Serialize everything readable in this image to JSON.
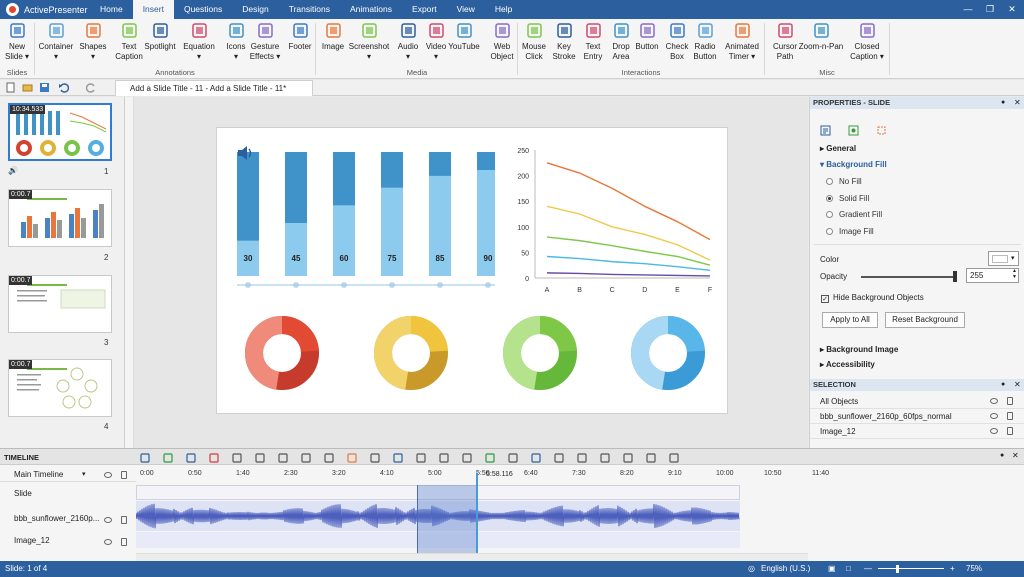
{
  "app": {
    "name": "ActivePresenter"
  },
  "menu_tabs": [
    "Home",
    "Insert",
    "Questions",
    "Design",
    "Transitions",
    "Animations",
    "Export",
    "View",
    "Help"
  ],
  "ribbon": {
    "slides": [
      {
        "label": "New",
        "label2": "Slide ▾"
      }
    ],
    "annotations": [
      {
        "label": "Container",
        "label2": "▾"
      },
      {
        "label": "Shapes",
        "label2": "▾"
      },
      {
        "label": "Text",
        "label2": "Caption"
      },
      {
        "label": "Spotlight",
        "label2": ""
      },
      {
        "label": "Equation",
        "label2": "▾"
      },
      {
        "label": "Icons",
        "label2": "▾"
      },
      {
        "label": "Gesture",
        "label2": "Effects ▾"
      },
      {
        "label": "Footer",
        "label2": ""
      }
    ],
    "media": [
      {
        "label": "Image",
        "label2": ""
      },
      {
        "label": "Screenshot",
        "label2": "▾"
      },
      {
        "label": "Audio",
        "label2": "▾"
      },
      {
        "label": "Video",
        "label2": "▾"
      },
      {
        "label": "YouTube",
        "label2": ""
      },
      {
        "label": "Web",
        "label2": "Object"
      }
    ],
    "interactions": [
      {
        "label": "Mouse",
        "label2": "Click"
      },
      {
        "label": "Key",
        "label2": "Stroke"
      },
      {
        "label": "Text",
        "label2": "Entry"
      },
      {
        "label": "Drop",
        "label2": "Area"
      },
      {
        "label": "Button",
        "label2": ""
      },
      {
        "label": "Check",
        "label2": "Box"
      },
      {
        "label": "Radio",
        "label2": "Button"
      },
      {
        "label": "Animated",
        "label2": "Timer ▾"
      }
    ],
    "misc": [
      {
        "label": "Cursor",
        "label2": "Path"
      },
      {
        "label": "Zoom-n-Pan",
        "label2": ""
      },
      {
        "label": "Closed",
        "label2": "Caption ▾"
      }
    ],
    "groups": {
      "slides": "Slides",
      "annotations": "Annotations",
      "media": "Media",
      "interactions": "Interactions",
      "misc": "Misc"
    }
  },
  "document_tab": "Add a Slide Title - 11 - Add a Slide Title - 11*",
  "slides_panel": [
    {
      "num": "1",
      "time": "10:34.533"
    },
    {
      "num": "2",
      "time": "0:00.7"
    },
    {
      "num": "3",
      "time": "0:00.7"
    },
    {
      "num": "4",
      "time": "0:00.7"
    }
  ],
  "chart_data": [
    {
      "type": "bar",
      "values": [
        30,
        45,
        60,
        75,
        85,
        90
      ],
      "ylim": [
        0,
        100
      ],
      "colors": {
        "track": "#3f93c8",
        "fill": "#8ccbee"
      }
    },
    {
      "type": "line",
      "categories": [
        "A",
        "B",
        "C",
        "D",
        "E",
        "F"
      ],
      "ylim": [
        0,
        250
      ],
      "yticks": [
        0,
        50,
        100,
        150,
        200,
        250
      ],
      "series": [
        {
          "color": "#e8783a",
          "values": [
            225,
            205,
            175,
            140,
            110,
            75
          ]
        },
        {
          "color": "#f0c84a",
          "values": [
            140,
            125,
            100,
            85,
            65,
            35
          ]
        },
        {
          "color": "#7cc84b",
          "values": [
            80,
            73,
            63,
            52,
            42,
            25
          ]
        },
        {
          "color": "#4bb8e6",
          "values": [
            42,
            38,
            32,
            28,
            22,
            15
          ]
        },
        {
          "color": "#6a4aa0",
          "values": [
            10,
            9,
            7,
            6,
            5,
            4
          ]
        }
      ]
    },
    {
      "type": "pie",
      "donuts": [
        {
          "base": "#c63b2c",
          "light": "#f08a7a",
          "accent": "#e24a34"
        },
        {
          "base": "#c99a2a",
          "light": "#f2d36a",
          "accent": "#f0c43c"
        },
        {
          "base": "#66b83a",
          "light": "#b5e28d",
          "accent": "#7fc847"
        },
        {
          "base": "#3a9bd6",
          "light": "#a8d8f3",
          "accent": "#59b6e8"
        }
      ]
    }
  ],
  "properties": {
    "title": "PROPERTIES - SLIDE",
    "general": "General",
    "background_fill": "Background Fill",
    "fill_options": [
      "No Fill",
      "Solid Fill",
      "Gradient Fill",
      "Image Fill"
    ],
    "selected_fill": "Solid Fill",
    "color_label": "Color",
    "opacity_label": "Opacity",
    "opacity_value": "255",
    "hide_bg": "Hide Background Objects",
    "apply_all": "Apply to All",
    "reset_bg": "Reset Background",
    "background_image": "Background Image",
    "accessibility": "Accessibility"
  },
  "selection": {
    "title": "SELECTION",
    "rows": [
      "All Objects",
      "bbb_sunflower_2160p_60fps_normal",
      "Image_12"
    ]
  },
  "timeline": {
    "title": "TIMELINE",
    "main": "Main Timeline",
    "tracks": [
      "Slide",
      "bbb_sunflower_2160p...",
      "Image_12"
    ],
    "ticks": [
      "0:00",
      "0:50",
      "1:40",
      "2:30",
      "3:20",
      "4:10",
      "5:00",
      "5:50",
      "6:40",
      "7:30",
      "8:20",
      "9:10",
      "10:00",
      "10:50",
      "11:40"
    ],
    "playhead": "5:58.116"
  },
  "status": {
    "slide": "Slide: 1 of 4",
    "language": "English (U.S.)",
    "zoom": "75%"
  }
}
